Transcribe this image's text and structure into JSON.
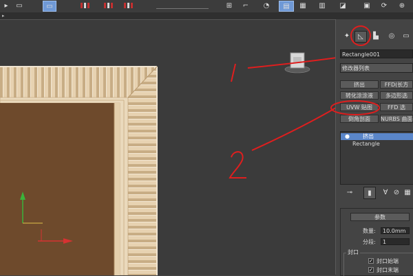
{
  "toolbar": {
    "icons": [
      "arrow-icon",
      "selection-icon",
      "link-icon",
      "unlink-icon",
      "bind-icon",
      "unbind-icon",
      "layers-icon",
      "align-icon",
      "render-icon",
      "render-frame-icon",
      "render-active-icon",
      "material-icon"
    ]
  },
  "viewport": {
    "axis_y": "y",
    "axis_x": "x",
    "colors": {
      "background": "#3b3b3b",
      "wood_fill": "#6e4a2c",
      "frame": "#dfc6a1",
      "axis_y": "#3bb33b",
      "axis_x": "#d63232",
      "annotation": "#e01e1e"
    },
    "annotations": [
      "1",
      "2"
    ]
  },
  "command_panel": {
    "tabs": [
      "create",
      "modify",
      "hierarchy",
      "motion",
      "display"
    ],
    "active_tab": "modify",
    "object_name": "Rectangle001",
    "modifier_list": "修改器列表",
    "modifier_buttons": [
      [
        "挤出",
        "FFD(长方"
      ],
      [
        "转化涂涂液",
        "多边形选"
      ],
      [
        "UVW 贴图",
        "FFD 选"
      ],
      [
        "倒角剖面",
        "NURBS 曲面"
      ]
    ],
    "stack": [
      {
        "label": "挤出",
        "selected": true
      },
      {
        "label": "Rectangle",
        "selected": false
      }
    ],
    "params": {
      "title": "参数",
      "amount_label": "数量:",
      "amount_value": "10.0mm",
      "segments_label": "分段:",
      "segments_value": "1",
      "capping_label": "封口",
      "cap_start": "封口始端",
      "cap_end": "封口末端"
    }
  }
}
